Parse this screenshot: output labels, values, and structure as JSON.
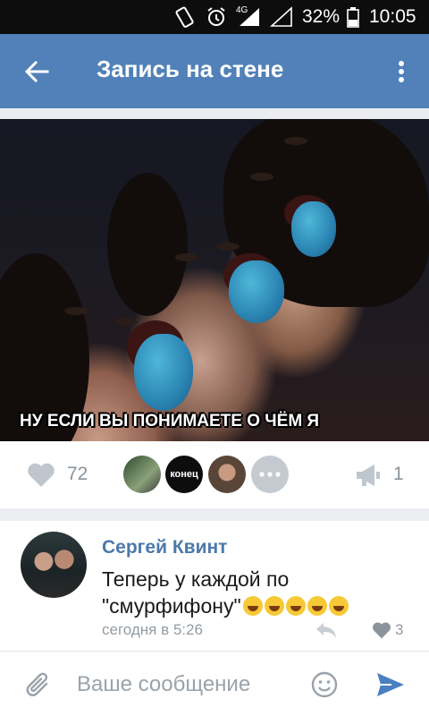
{
  "status_bar": {
    "network": "4G",
    "battery": "32%",
    "time": "10:05"
  },
  "toolbar": {
    "title": "Запись на стене",
    "back_icon": "arrow-left-icon",
    "more_icon": "more-vertical-icon",
    "color": "#5181b8"
  },
  "post": {
    "image_caption": "НУ ЕСЛИ ВЫ ПОНИМАЕТЕ О ЧЁМ Я",
    "likes": "72",
    "liker_badge": "конец",
    "shares": "1"
  },
  "comment": {
    "author": "Сергей Квинт",
    "text": "Теперь у каждой по \"смурфифону\"",
    "emoji_count": 5,
    "time": "сегодня в 5:26",
    "likes": "3"
  },
  "composer": {
    "placeholder": "Ваше сообщение"
  },
  "colors": {
    "accent": "#5181b8",
    "author_link": "#4b79ab",
    "meta_gray": "#8a939b",
    "send": "#4a7fc1"
  }
}
